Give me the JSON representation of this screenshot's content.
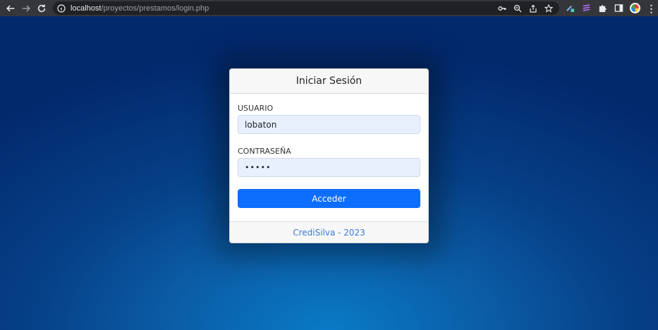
{
  "browser": {
    "url_host": "localhost",
    "url_path": "/proyectos/prestamos/login.php"
  },
  "login": {
    "title": "Iniciar Sesión",
    "username_label": "USUARIO",
    "username_value": "lobaton",
    "password_label": "CONTRASEÑA",
    "password_mask": "•••••",
    "submit_label": "Acceder",
    "footer_text": "CrediSilva - 2023"
  },
  "colors": {
    "primary_button": "#0d6efd",
    "footer_link": "#3d7cd6",
    "input_autofill": "#e8f0fe"
  }
}
